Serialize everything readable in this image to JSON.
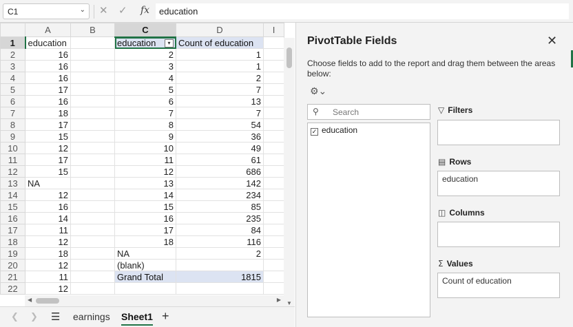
{
  "formula_bar": {
    "name_box": "C1",
    "fx": "fx",
    "content": "education"
  },
  "grid": {
    "columns": [
      "A",
      "B",
      "C",
      "D",
      "I"
    ],
    "rows": [
      {
        "n": "1",
        "a": "education",
        "b": "",
        "c": "education",
        "d": "Count of education"
      },
      {
        "n": "2",
        "a": "16",
        "b": "",
        "c": "2",
        "d": "1"
      },
      {
        "n": "3",
        "a": "16",
        "b": "",
        "c": "3",
        "d": "1"
      },
      {
        "n": "4",
        "a": "16",
        "b": "",
        "c": "4",
        "d": "2"
      },
      {
        "n": "5",
        "a": "17",
        "b": "",
        "c": "5",
        "d": "7"
      },
      {
        "n": "6",
        "a": "16",
        "b": "",
        "c": "6",
        "d": "13"
      },
      {
        "n": "7",
        "a": "18",
        "b": "",
        "c": "7",
        "d": "7"
      },
      {
        "n": "8",
        "a": "17",
        "b": "",
        "c": "8",
        "d": "54"
      },
      {
        "n": "9",
        "a": "15",
        "b": "",
        "c": "9",
        "d": "36"
      },
      {
        "n": "10",
        "a": "12",
        "b": "",
        "c": "10",
        "d": "49"
      },
      {
        "n": "11",
        "a": "17",
        "b": "",
        "c": "11",
        "d": "61"
      },
      {
        "n": "12",
        "a": "15",
        "b": "",
        "c": "12",
        "d": "686"
      },
      {
        "n": "13",
        "a": "NA",
        "b": "",
        "c": "13",
        "d": "142"
      },
      {
        "n": "14",
        "a": "12",
        "b": "",
        "c": "14",
        "d": "234"
      },
      {
        "n": "15",
        "a": "16",
        "b": "",
        "c": "15",
        "d": "85"
      },
      {
        "n": "16",
        "a": "14",
        "b": "",
        "c": "16",
        "d": "235"
      },
      {
        "n": "17",
        "a": "11",
        "b": "",
        "c": "17",
        "d": "84"
      },
      {
        "n": "18",
        "a": "12",
        "b": "",
        "c": "18",
        "d": "116"
      },
      {
        "n": "19",
        "a": "18",
        "b": "",
        "c": "NA",
        "d": "2"
      },
      {
        "n": "20",
        "a": "12",
        "b": "",
        "c": "(blank)",
        "d": ""
      },
      {
        "n": "21",
        "a": "11",
        "b": "",
        "c": "Grand Total",
        "d": "1815"
      },
      {
        "n": "22",
        "a": "12",
        "b": "",
        "c": "",
        "d": ""
      }
    ]
  },
  "sheet_tabs": {
    "tabs": [
      "earnings",
      "Sheet1"
    ],
    "active": "Sheet1",
    "add_label": "+"
  },
  "pivot_pane": {
    "title": "PivotTable Fields",
    "description": "Choose fields to add to the report and drag them between the areas below:",
    "search_placeholder": "Search",
    "fields": [
      {
        "name": "education",
        "checked": true
      }
    ],
    "filters_label": "Filters",
    "filters_value": "",
    "rows_label": "Rows",
    "rows_value": "education",
    "columns_label": "Columns",
    "columns_value": "",
    "values_label": "Values",
    "values_value": "Count of education"
  },
  "colors": {
    "accent": "#217346",
    "pivot_header_bg": "#dce3f2",
    "pane_bg": "#f3f3f3"
  },
  "icons": [
    "cancel-icon",
    "confirm-icon",
    "gear-icon",
    "search-icon",
    "close-icon",
    "filter-icon",
    "rows-icon",
    "columns-icon",
    "sigma-icon"
  ]
}
